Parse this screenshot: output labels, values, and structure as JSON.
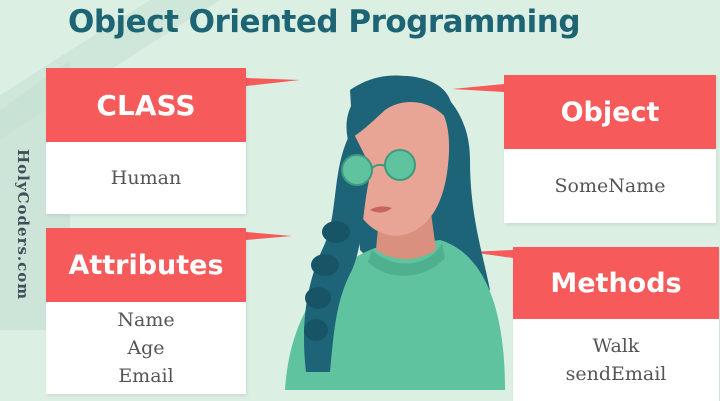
{
  "side_label": "HolyCoders.com",
  "title": "Object Oriented Programming",
  "colors": {
    "accent": "#f65a5b",
    "title": "#1d6474",
    "background": "#dcefe3",
    "shirt": "#5fc3a0",
    "hair": "#1d6478",
    "skin": "#e8a596"
  },
  "cards": {
    "class": {
      "heading": "CLASS",
      "items": [
        "Human"
      ]
    },
    "attributes": {
      "heading": "Attributes",
      "items": [
        "Name",
        "Age",
        "Email"
      ]
    },
    "object": {
      "heading": "Object",
      "items": [
        "SomeName"
      ]
    },
    "methods": {
      "heading": "Methods",
      "items": [
        "Walk",
        "sendEmail"
      ]
    }
  },
  "illustration": "woman-with-round-glasses-icon"
}
